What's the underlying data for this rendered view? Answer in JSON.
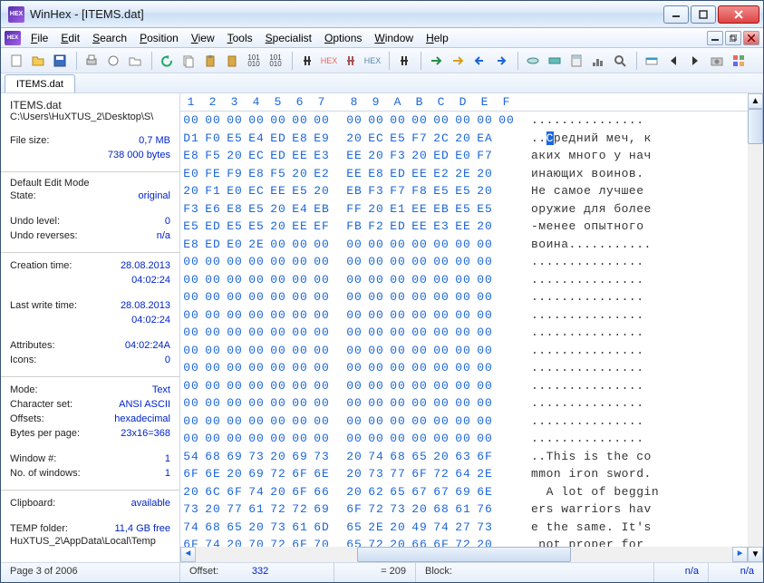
{
  "window": {
    "title": "WinHex - [ITEMS.dat]"
  },
  "menu": [
    "File",
    "Edit",
    "Search",
    "Position",
    "View",
    "Tools",
    "Specialist",
    "Options",
    "Window",
    "Help"
  ],
  "tab": "ITEMS.dat",
  "side": {
    "filename": "ITEMS.dat",
    "path": "C:\\Users\\HuXTUS_2\\Desktop\\S\\",
    "filesize_label": "File size:",
    "filesize1": "0,7 MB",
    "filesize2": "738 000 bytes",
    "editmode_label": "Default Edit Mode",
    "state_label": "State:",
    "state": "original",
    "undo_level_label": "Undo level:",
    "undo_level": "0",
    "undo_rev_label": "Undo reverses:",
    "undo_rev": "n/a",
    "ctime_label": "Creation time:",
    "ctime1": "28.08.2013",
    "ctime2": "04:02:24",
    "wtime_label": "Last write time:",
    "wtime1": "28.08.2013",
    "wtime2": "04:02:24",
    "attr_label": "Attributes:",
    "attr": "04:02:24A",
    "icons_label": "Icons:",
    "icons": "0",
    "mode_label": "Mode:",
    "mode": "Text",
    "charset_label": "Character set:",
    "charset": "ANSI ASCII",
    "offsets_label": "Offsets:",
    "offsets": "hexadecimal",
    "bpp_label": "Bytes per page:",
    "bpp": "23x16=368",
    "win_label": "Window #:",
    "win": "1",
    "wins_label": "No. of windows:",
    "wins": "1",
    "clip_label": "Clipboard:",
    "clip": "available",
    "temp_label": "TEMP folder:",
    "temp": "11,4 GB free",
    "temp_path": "HuXTUS_2\\AppData\\Local\\Temp"
  },
  "hexhdr": [
    "1",
    "2",
    "3",
    "4",
    "5",
    "6",
    "7",
    "8",
    "9",
    "A",
    "B",
    "C",
    "D",
    "E",
    "F"
  ],
  "rows": [
    {
      "b": [
        "00",
        "00",
        "00",
        "00",
        "00",
        "00",
        "00",
        "00",
        "00",
        "00",
        "00",
        "00",
        "00",
        "00",
        "00"
      ],
      "t": "..............."
    },
    {
      "b": [
        "D1",
        "F0",
        "E5",
        "E4",
        "ED",
        "E8",
        "E9",
        "20",
        "EC",
        "E5",
        "F7",
        "2C",
        "20",
        "EA"
      ],
      "t": "..Средний меч, к",
      "hl": 2
    },
    {
      "b": [
        "E8",
        "F5",
        "20",
        "EC",
        "ED",
        "EE",
        "E3",
        "EE",
        "20",
        "F3",
        "20",
        "ED",
        "E0",
        "F7"
      ],
      "t": "аких много у нач"
    },
    {
      "b": [
        "E0",
        "FE",
        "F9",
        "E8",
        "F5",
        "20",
        "E2",
        "EE",
        "E8",
        "ED",
        "EE",
        "E2",
        "2E",
        "20"
      ],
      "t": "инающих воинов. "
    },
    {
      "b": [
        "20",
        "F1",
        "E0",
        "EC",
        "EE",
        "E5",
        "20",
        "EB",
        "F3",
        "F7",
        "F8",
        "E5",
        "E5",
        "20"
      ],
      "t": "Не самое лучшее "
    },
    {
      "b": [
        "F3",
        "E6",
        "E8",
        "E5",
        "20",
        "E4",
        "EB",
        "FF",
        "20",
        "E1",
        "EE",
        "EB",
        "E5",
        "E5"
      ],
      "t": "оружие для более"
    },
    {
      "b": [
        "E5",
        "ED",
        "E5",
        "E5",
        "20",
        "EE",
        "EF",
        "FB",
        "F2",
        "ED",
        "EE",
        "E3",
        "EE",
        "20"
      ],
      "t": "-менее опытного "
    },
    {
      "b": [
        "E8",
        "ED",
        "E0",
        "2E",
        "00",
        "00",
        "00",
        "00",
        "00",
        "00",
        "00",
        "00",
        "00",
        "00"
      ],
      "t": "воина..........."
    },
    {
      "b": [
        "00",
        "00",
        "00",
        "00",
        "00",
        "00",
        "00",
        "00",
        "00",
        "00",
        "00",
        "00",
        "00",
        "00"
      ],
      "t": "..............."
    },
    {
      "b": [
        "00",
        "00",
        "00",
        "00",
        "00",
        "00",
        "00",
        "00",
        "00",
        "00",
        "00",
        "00",
        "00",
        "00"
      ],
      "t": "..............."
    },
    {
      "b": [
        "00",
        "00",
        "00",
        "00",
        "00",
        "00",
        "00",
        "00",
        "00",
        "00",
        "00",
        "00",
        "00",
        "00"
      ],
      "t": "..............."
    },
    {
      "b": [
        "00",
        "00",
        "00",
        "00",
        "00",
        "00",
        "00",
        "00",
        "00",
        "00",
        "00",
        "00",
        "00",
        "00"
      ],
      "t": "..............."
    },
    {
      "b": [
        "00",
        "00",
        "00",
        "00",
        "00",
        "00",
        "00",
        "00",
        "00",
        "00",
        "00",
        "00",
        "00",
        "00"
      ],
      "t": "..............."
    },
    {
      "b": [
        "00",
        "00",
        "00",
        "00",
        "00",
        "00",
        "00",
        "00",
        "00",
        "00",
        "00",
        "00",
        "00",
        "00"
      ],
      "t": "..............."
    },
    {
      "b": [
        "00",
        "00",
        "00",
        "00",
        "00",
        "00",
        "00",
        "00",
        "00",
        "00",
        "00",
        "00",
        "00",
        "00"
      ],
      "t": "..............."
    },
    {
      "b": [
        "00",
        "00",
        "00",
        "00",
        "00",
        "00",
        "00",
        "00",
        "00",
        "00",
        "00",
        "00",
        "00",
        "00"
      ],
      "t": "..............."
    },
    {
      "b": [
        "00",
        "00",
        "00",
        "00",
        "00",
        "00",
        "00",
        "00",
        "00",
        "00",
        "00",
        "00",
        "00",
        "00"
      ],
      "t": "..............."
    },
    {
      "b": [
        "00",
        "00",
        "00",
        "00",
        "00",
        "00",
        "00",
        "00",
        "00",
        "00",
        "00",
        "00",
        "00",
        "00"
      ],
      "t": "..............."
    },
    {
      "b": [
        "00",
        "00",
        "00",
        "00",
        "00",
        "00",
        "00",
        "00",
        "00",
        "00",
        "00",
        "00",
        "00",
        "00"
      ],
      "t": "..............."
    },
    {
      "b": [
        "54",
        "68",
        "69",
        "73",
        "20",
        "69",
        "73",
        "20",
        "74",
        "68",
        "65",
        "20",
        "63",
        "6F"
      ],
      "t": "..This is the co"
    },
    {
      "b": [
        "6F",
        "6E",
        "20",
        "69",
        "72",
        "6F",
        "6E",
        "20",
        "73",
        "77",
        "6F",
        "72",
        "64",
        "2E"
      ],
      "t": "mmon iron sword."
    },
    {
      "b": [
        "20",
        "6C",
        "6F",
        "74",
        "20",
        "6F",
        "66",
        "20",
        "62",
        "65",
        "67",
        "67",
        "69",
        "6E"
      ],
      "t": "  A lot of beggin"
    },
    {
      "b": [
        "73",
        "20",
        "77",
        "61",
        "72",
        "72",
        "69",
        "6F",
        "72",
        "73",
        "20",
        "68",
        "61",
        "76"
      ],
      "t": "ers warriors hav"
    },
    {
      "b": [
        "74",
        "68",
        "65",
        "20",
        "73",
        "61",
        "6D",
        "65",
        "2E",
        "20",
        "49",
        "74",
        "27",
        "73"
      ],
      "t": "e the same. It's"
    },
    {
      "b": [
        "6F",
        "74",
        "20",
        "70",
        "72",
        "6F",
        "70",
        "65",
        "72",
        "20",
        "66",
        "6F",
        "72",
        "20"
      ],
      "t": " not proper for "
    }
  ],
  "status": {
    "page": "Page 3 of 2006",
    "offset_label": "Offset:",
    "offset": "332",
    "eq": "= 209",
    "block_label": "Block:",
    "block": "n/a",
    "size": "n/a"
  }
}
